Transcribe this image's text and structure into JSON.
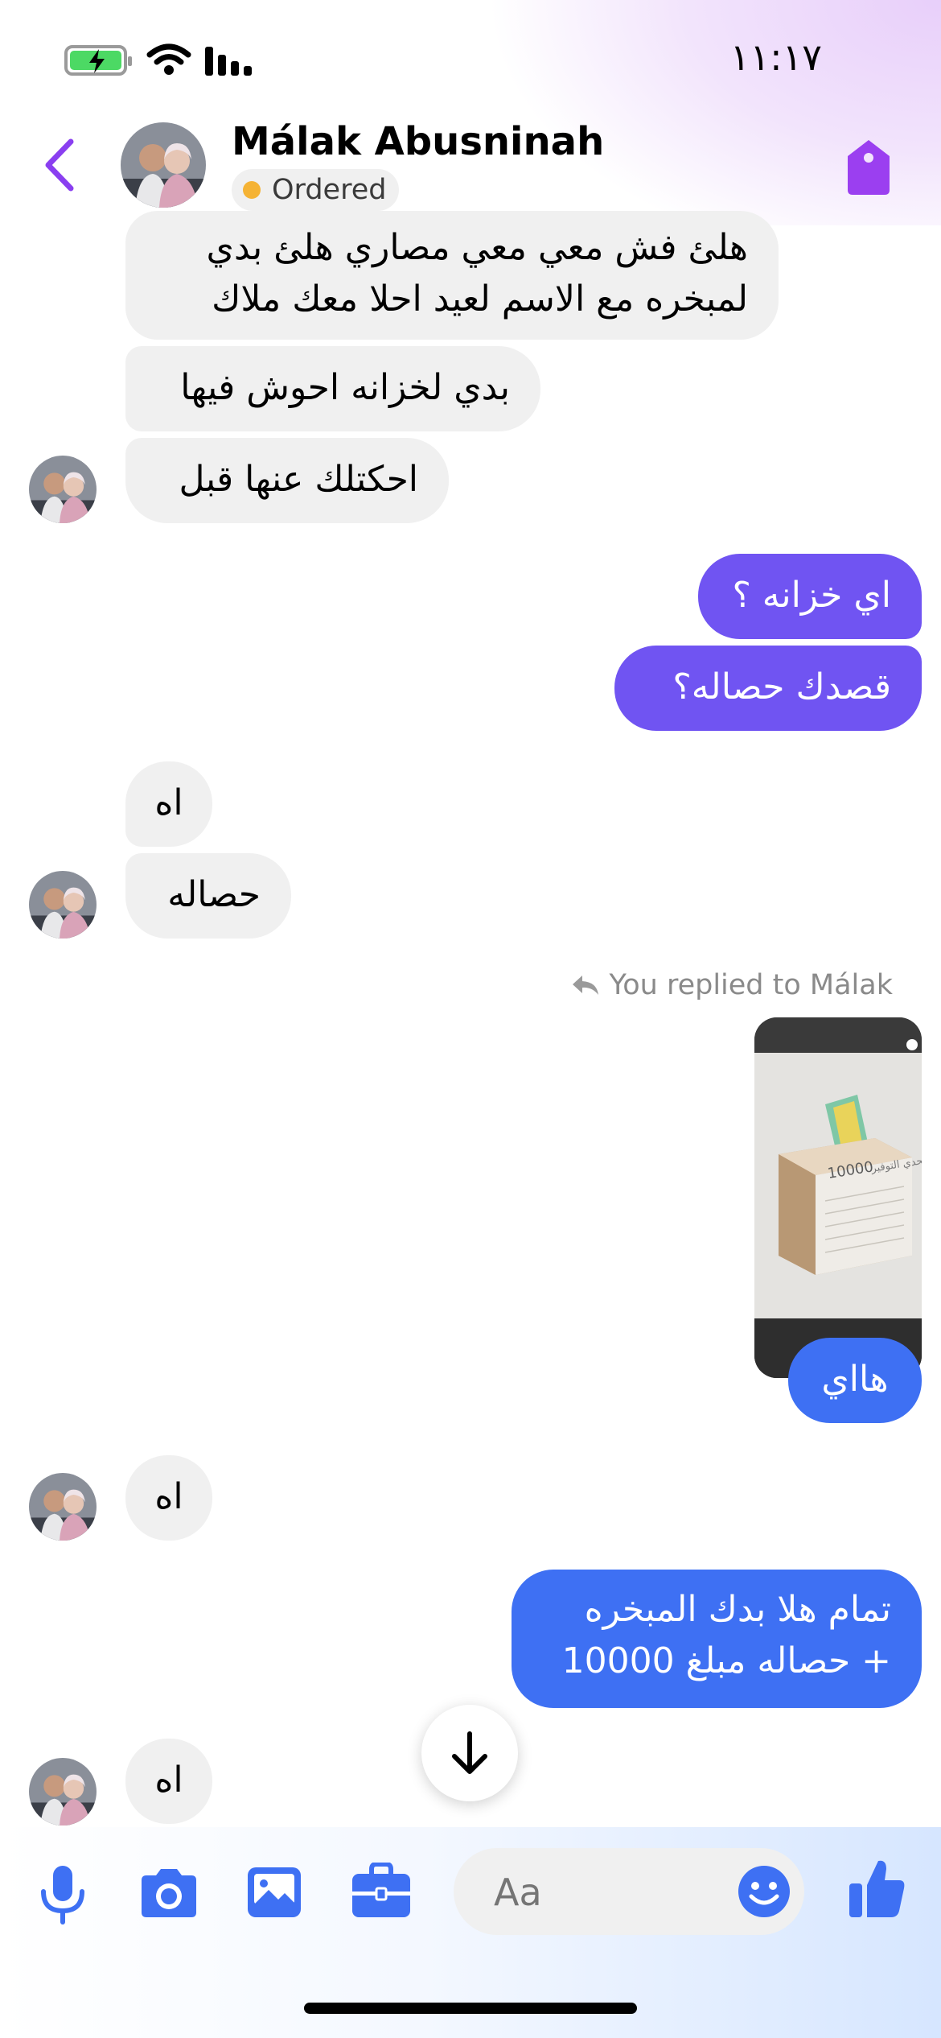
{
  "status_bar": {
    "time": "١١:١٧"
  },
  "header": {
    "contact_name": "Málak Abusninah",
    "status_label": "Ordered"
  },
  "messages": {
    "m1_line1": "هلئ فش معي معي مصاري هلئ بدي",
    "m1_line2": "لمبخره مع الاسم لعيد احلا معك ملاك",
    "m2": "بدي لخزانه احوش فيها",
    "m3": "احكتلك عنها قبل",
    "m4": "اي خزانه ؟",
    "m5": "قصدك حصاله؟",
    "m6": "اه",
    "m7": "حصاله",
    "reply_label": "You replied to Málak",
    "photo_caption": "تحدي التوفير",
    "photo_number": "10000",
    "m8": "هااي",
    "m9": "اه",
    "m10_line1": "تمام هلا بدك المبخره",
    "m10_line2": "+ حصاله مبلغ 10000",
    "m11": "اه"
  },
  "composer": {
    "placeholder": "Aa"
  },
  "colors": {
    "accent_purple": "#7054f2",
    "accent_blue": "#3e70f3",
    "incoming_bg": "#f0f0f0",
    "ordered_dot": "#f5b335"
  }
}
